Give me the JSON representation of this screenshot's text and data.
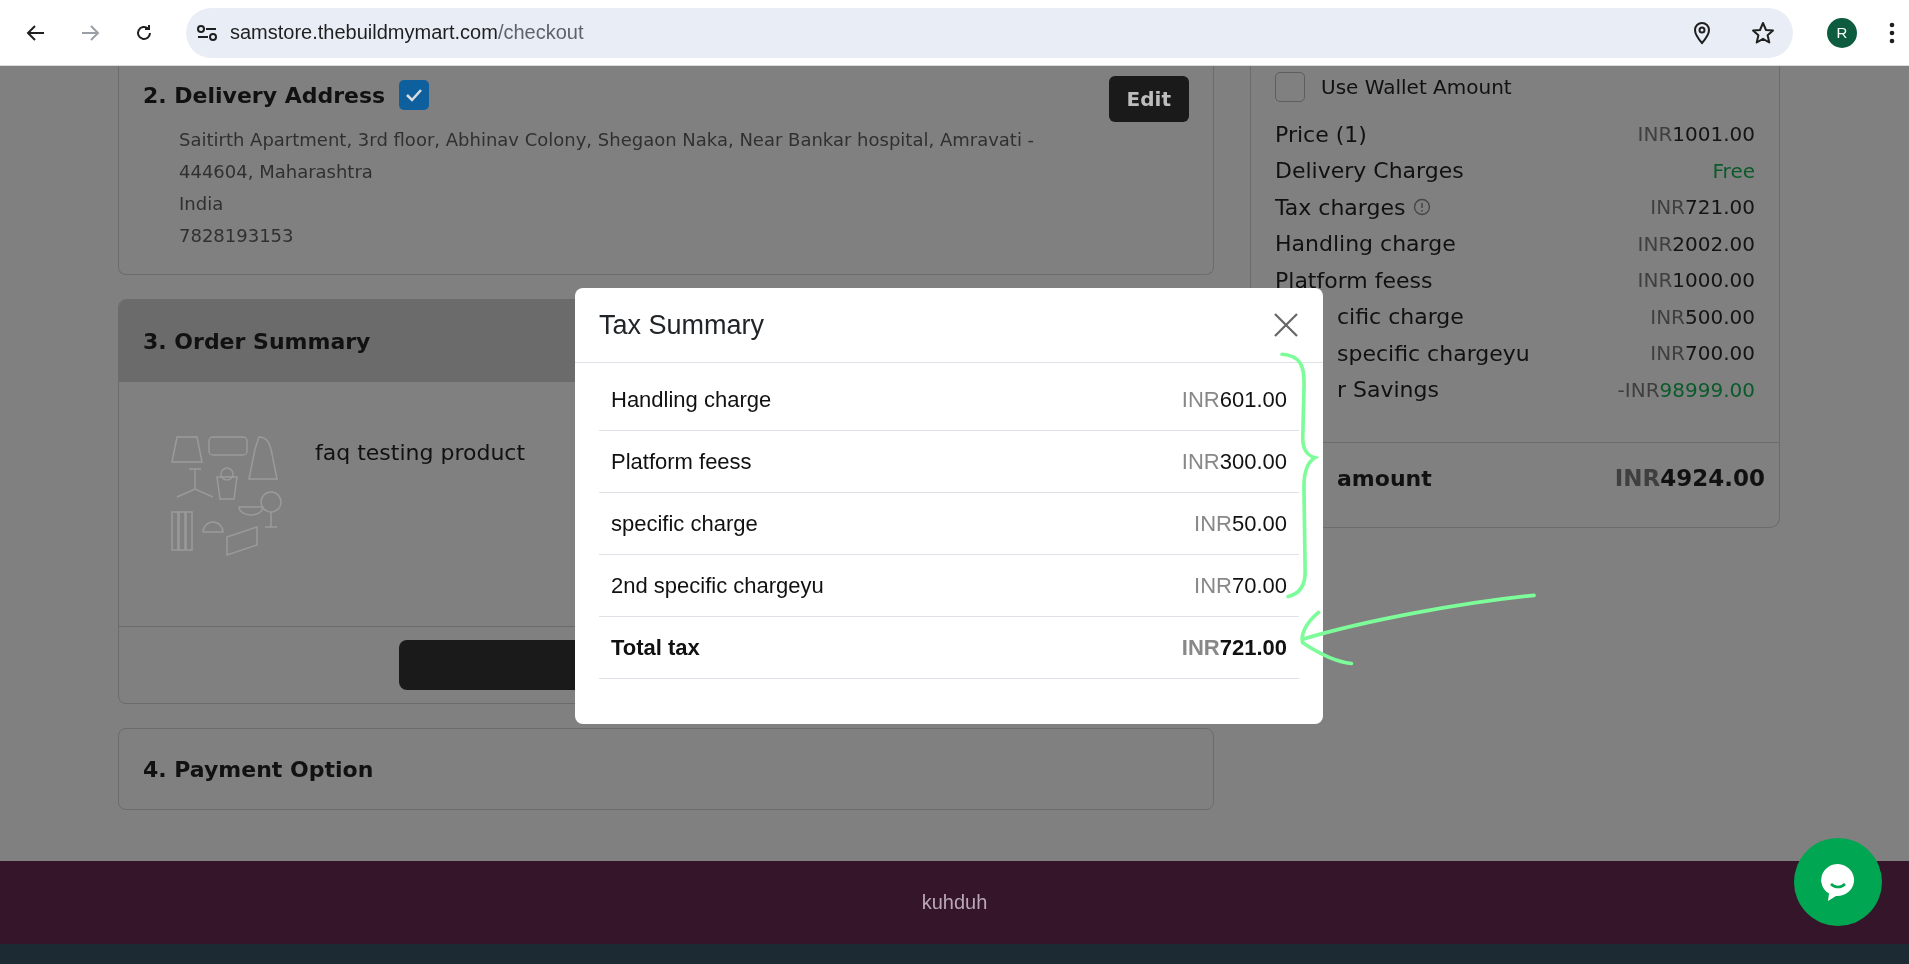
{
  "browser": {
    "url_host": "samstore.thebuildmymart.com",
    "url_path": "/checkout",
    "avatar": "R"
  },
  "delivery": {
    "title": "2. Delivery Address",
    "checked": true,
    "edit": "Edit",
    "lines": [
      "Saitirth Apartment, 3rd floor, Abhinav Colony, Shegaon Naka, Near Bankar hospital, Amravati -",
      "444604, Maharashtra",
      "India",
      "7828193153"
    ]
  },
  "order_summary": {
    "title": "3. Order Summary",
    "product": "faq testing product"
  },
  "payment": {
    "title": "4. Payment Option"
  },
  "price_panel": {
    "wallet": {
      "label": "Use Wallet Amount",
      "checked": false
    },
    "rows": [
      {
        "label": "Price (1)",
        "kind": "amount",
        "info": false,
        "clipped": false,
        "currency": "INR",
        "amount": "1001.00"
      },
      {
        "label": "Delivery Charges",
        "kind": "free",
        "info": false,
        "clipped": false,
        "amount": "Free"
      },
      {
        "label": "Tax charges",
        "kind": "amount",
        "info": true,
        "clipped": false,
        "currency": "INR",
        "amount": "721.00"
      },
      {
        "label": "Handling charge",
        "kind": "amount",
        "info": false,
        "clipped": false,
        "currency": "INR",
        "amount": "2002.00"
      },
      {
        "label": "Platform feess",
        "kind": "amount",
        "info": false,
        "clipped": false,
        "currency": "INR",
        "amount": "1000.00"
      },
      {
        "label": "cific charge",
        "kind": "amount",
        "info": false,
        "clipped": true,
        "currency": "INR",
        "amount": "500.00"
      },
      {
        "label": "specific chargeyu",
        "kind": "amount",
        "info": false,
        "clipped": true,
        "currency": "INR",
        "amount": "700.00"
      },
      {
        "label": "r Savings",
        "kind": "savings",
        "info": false,
        "clipped": true,
        "currency": "-INR",
        "amount": "98999.00"
      }
    ],
    "total": {
      "label": "amount",
      "currency": "INR",
      "amount": "4924.00"
    }
  },
  "modal": {
    "title": "Tax Summary",
    "rows": [
      {
        "label": "Handling charge",
        "kind": "line",
        "currency": "INR",
        "amount": "601.00"
      },
      {
        "label": "Platform feess",
        "kind": "line",
        "currency": "INR",
        "amount": "300.00"
      },
      {
        "label": "specific charge",
        "kind": "line",
        "currency": "INR",
        "amount": "50.00"
      },
      {
        "label": "2nd specific chargeyu",
        "kind": "line",
        "currency": "INR",
        "amount": "70.00"
      },
      {
        "label": "Total tax",
        "kind": "total",
        "currency": "INR",
        "amount": "721.00"
      }
    ]
  },
  "footer": {
    "text": "kuhduh"
  }
}
